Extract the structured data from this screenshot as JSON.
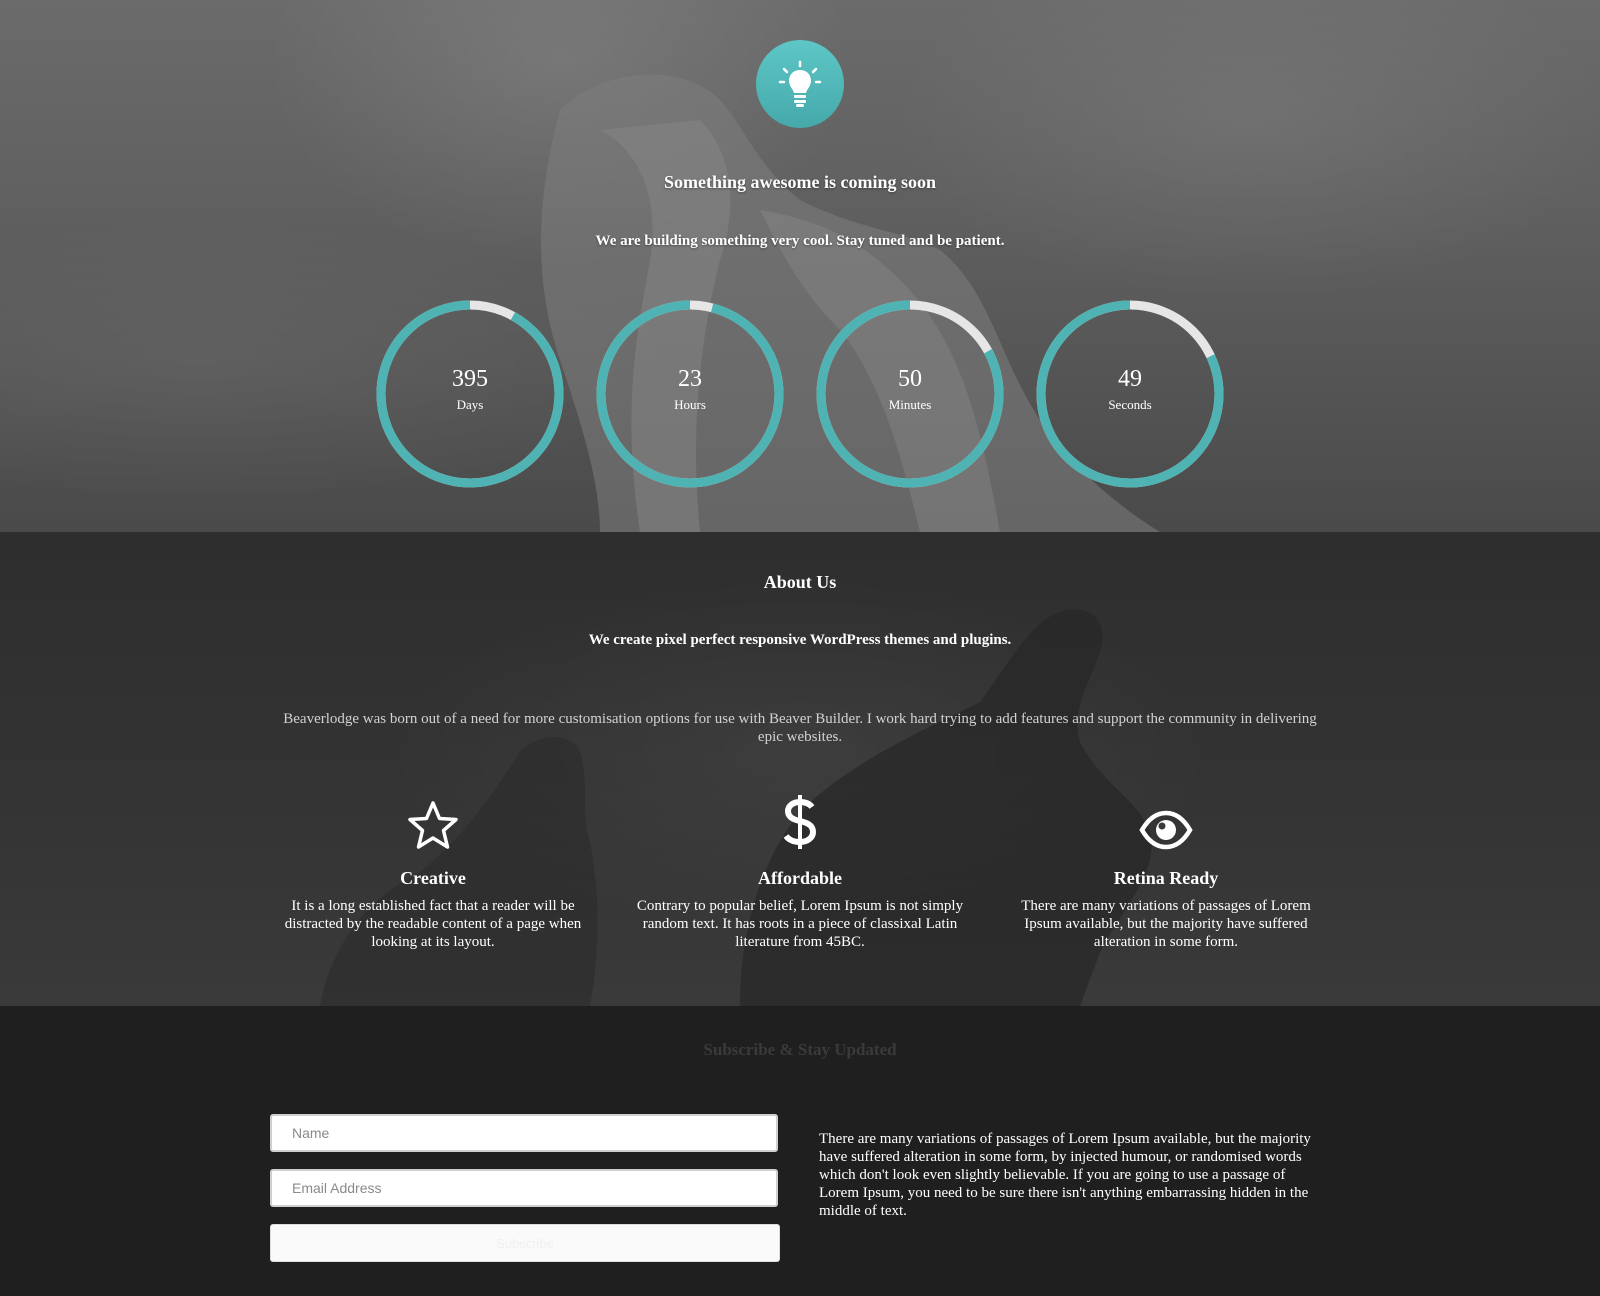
{
  "hero": {
    "icon": "lightbulb-icon",
    "accent": "#4fb3b3",
    "title": "Something awesome is coming soon",
    "subtitle": "We are building something very cool. Stay tuned and be patient.",
    "countdown": [
      {
        "value": "395",
        "label": "Days",
        "fraction": 0.92
      },
      {
        "value": "23",
        "label": "Hours",
        "fraction": 0.96
      },
      {
        "value": "50",
        "label": "Minutes",
        "fraction": 0.83
      },
      {
        "value": "49",
        "label": "Seconds",
        "fraction": 0.82
      }
    ]
  },
  "about": {
    "title": "About Us",
    "subtitle": "We create pixel perfect responsive WordPress themes and plugins.",
    "text": "Beaverlodge was born out of a need for more customisation options for use with Beaver Builder. I work hard trying to add features and support the community in delivering epic websites.",
    "features": [
      {
        "icon": "star-icon",
        "title": "Creative",
        "text": "It is a long established fact that a reader will be distracted by the readable content of a page when looking at its layout."
      },
      {
        "icon": "dollar-icon",
        "title": "Affordable",
        "text": "Contrary to popular belief, Lorem Ipsum is not simply random text. It has roots in a piece of classixal Latin literature from 45BC."
      },
      {
        "icon": "eye-icon",
        "title": "Retina Ready",
        "text": "There are many variations of passages of Lorem Ipsum available, but the majority have suffered alteration in some form."
      }
    ]
  },
  "subscribe": {
    "title": "Subscribe & Stay Updated",
    "name_placeholder": "Name",
    "email_placeholder": "Email Address",
    "button_label": "Subscribe",
    "text": "There are many variations of passages of Lorem Ipsum available, but the majority have suffered alteration in some form, by injected humour, or randomised words which don't look even slightly believable. If you are going to use a passage of Lorem Ipsum, you need to be sure there isn't anything embarrassing hidden in the middle of text."
  }
}
